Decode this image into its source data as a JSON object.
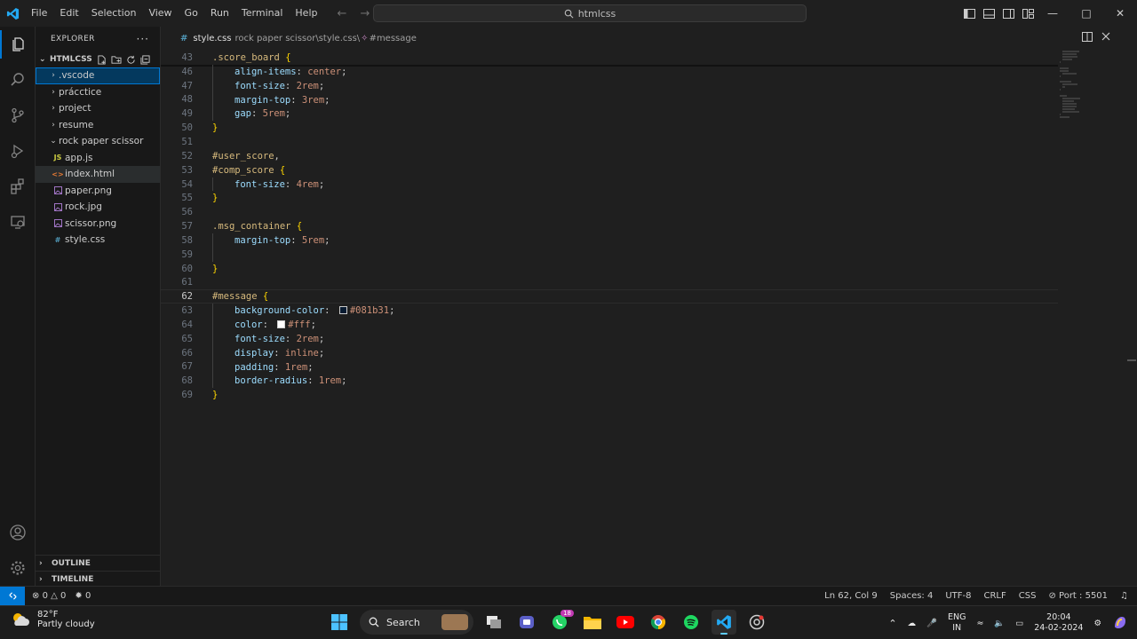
{
  "title_bar": {
    "menu": [
      "File",
      "Edit",
      "Selection",
      "View",
      "Go",
      "Run",
      "Terminal",
      "Help"
    ],
    "command_center": "htmlcss",
    "colors": {
      "accent": "#0078d4",
      "selection_bg": "#04395e"
    }
  },
  "sidebar": {
    "header": "EXPLORER",
    "root": "HTMLCSS",
    "tree": [
      {
        "label": ".vscode",
        "type": "folder",
        "expanded": false,
        "depth": 0,
        "selected": true
      },
      {
        "label": "prácctice",
        "type": "folder",
        "expanded": false,
        "depth": 0
      },
      {
        "label": "project",
        "type": "folder",
        "expanded": false,
        "depth": 0
      },
      {
        "label": "resume",
        "type": "folder",
        "expanded": false,
        "depth": 0
      },
      {
        "label": "rock paper scissor",
        "type": "folder",
        "expanded": true,
        "depth": 0
      },
      {
        "label": "app.js",
        "type": "js",
        "depth": 1,
        "icon_text": "JS"
      },
      {
        "label": "index.html",
        "type": "html",
        "depth": 1,
        "icon_text": "<>",
        "hover": true
      },
      {
        "label": "paper.png",
        "type": "img",
        "depth": 1
      },
      {
        "label": "rock.jpg",
        "type": "img",
        "depth": 1
      },
      {
        "label": "scissor.png",
        "type": "img",
        "depth": 1
      },
      {
        "label": "style.css",
        "type": "css",
        "depth": 1,
        "icon_text": "#"
      }
    ],
    "outline": "OUTLINE",
    "timeline": "TIMELINE"
  },
  "editor": {
    "tab_file": "style.css",
    "breadcrumb_path": "rock paper scissor\\style.css\\",
    "breadcrumb_symbol": "#message",
    "current_line": 62,
    "sticky": {
      "ln": 43,
      "tokens": [
        [
          ".score_board",
          "sel"
        ],
        [
          " ",
          "punc"
        ],
        [
          "{",
          "brace"
        ]
      ]
    },
    "lines": [
      {
        "ln": 46,
        "indent": 1,
        "tokens": [
          [
            "align-items",
            "prop"
          ],
          [
            ": ",
            "punc"
          ],
          [
            "center",
            "val"
          ],
          [
            ";",
            "punc"
          ]
        ]
      },
      {
        "ln": 47,
        "indent": 1,
        "tokens": [
          [
            "font-size",
            "prop"
          ],
          [
            ": ",
            "punc"
          ],
          [
            "2rem",
            "val"
          ],
          [
            ";",
            "punc"
          ]
        ]
      },
      {
        "ln": 48,
        "indent": 1,
        "tokens": [
          [
            "margin-top",
            "prop"
          ],
          [
            ": ",
            "punc"
          ],
          [
            "3rem",
            "val"
          ],
          [
            ";",
            "punc"
          ]
        ]
      },
      {
        "ln": 49,
        "indent": 1,
        "tokens": [
          [
            "gap",
            "prop"
          ],
          [
            ": ",
            "punc"
          ],
          [
            "5rem",
            "val"
          ],
          [
            ";",
            "punc"
          ]
        ]
      },
      {
        "ln": 50,
        "indent": 0,
        "tokens": [
          [
            "}",
            "brace"
          ]
        ]
      },
      {
        "ln": 51,
        "indent": 0,
        "tokens": []
      },
      {
        "ln": 52,
        "indent": 0,
        "tokens": [
          [
            "#user_score",
            "sel"
          ],
          [
            ",",
            "punc"
          ]
        ]
      },
      {
        "ln": 53,
        "indent": 0,
        "tokens": [
          [
            "#comp_score",
            "sel"
          ],
          [
            " ",
            "punc"
          ],
          [
            "{",
            "brace"
          ]
        ]
      },
      {
        "ln": 54,
        "indent": 1,
        "tokens": [
          [
            "font-size",
            "prop"
          ],
          [
            ": ",
            "punc"
          ],
          [
            "4rem",
            "val"
          ],
          [
            ";",
            "punc"
          ]
        ]
      },
      {
        "ln": 55,
        "indent": 0,
        "tokens": [
          [
            "}",
            "brace"
          ]
        ]
      },
      {
        "ln": 56,
        "indent": 0,
        "tokens": []
      },
      {
        "ln": 57,
        "indent": 0,
        "tokens": [
          [
            ".msg_container",
            "sel"
          ],
          [
            " ",
            "punc"
          ],
          [
            "{",
            "brace"
          ]
        ]
      },
      {
        "ln": 58,
        "indent": 1,
        "tokens": [
          [
            "margin-top",
            "prop"
          ],
          [
            ": ",
            "punc"
          ],
          [
            "5rem",
            "val"
          ],
          [
            ";",
            "punc"
          ]
        ]
      },
      {
        "ln": 59,
        "indent": 1,
        "tokens": []
      },
      {
        "ln": 60,
        "indent": 0,
        "tokens": [
          [
            "}",
            "brace"
          ]
        ]
      },
      {
        "ln": 61,
        "indent": 0,
        "tokens": []
      },
      {
        "ln": 62,
        "indent": 0,
        "tokens": [
          [
            "#message",
            "sel"
          ],
          [
            " ",
            "punc"
          ],
          [
            "{",
            "brace"
          ]
        ]
      },
      {
        "ln": 63,
        "indent": 1,
        "tokens": [
          [
            "background-color",
            "prop"
          ],
          [
            ": ",
            "punc"
          ],
          [
            "#081b31",
            "val",
            "#081b31"
          ],
          [
            ";",
            "punc"
          ]
        ]
      },
      {
        "ln": 64,
        "indent": 1,
        "tokens": [
          [
            "color",
            "prop"
          ],
          [
            ": ",
            "punc"
          ],
          [
            "#fff",
            "val",
            "#ffffff"
          ],
          [
            ";",
            "punc"
          ]
        ]
      },
      {
        "ln": 65,
        "indent": 1,
        "tokens": [
          [
            "font-size",
            "prop"
          ],
          [
            ": ",
            "punc"
          ],
          [
            "2rem",
            "val"
          ],
          [
            ";",
            "punc"
          ]
        ]
      },
      {
        "ln": 66,
        "indent": 1,
        "tokens": [
          [
            "display",
            "prop"
          ],
          [
            ": ",
            "punc"
          ],
          [
            "inline",
            "val"
          ],
          [
            ";",
            "punc"
          ]
        ]
      },
      {
        "ln": 67,
        "indent": 1,
        "tokens": [
          [
            "padding",
            "prop"
          ],
          [
            ": ",
            "punc"
          ],
          [
            "1rem",
            "val"
          ],
          [
            ";",
            "punc"
          ]
        ]
      },
      {
        "ln": 68,
        "indent": 1,
        "tokens": [
          [
            "border-radius",
            "prop"
          ],
          [
            ": ",
            "punc"
          ],
          [
            "1rem",
            "val"
          ],
          [
            ";",
            "punc"
          ]
        ]
      },
      {
        "ln": 69,
        "indent": 0,
        "tokens": [
          [
            "}",
            "brace"
          ]
        ]
      }
    ]
  },
  "status_bar": {
    "errors": "0",
    "warnings": "0",
    "ports_left": "0",
    "cursor": "Ln 62, Col 9",
    "spaces": "Spaces: 4",
    "encoding": "UTF-8",
    "eol": "CRLF",
    "language": "CSS",
    "port": "Port : 5501"
  },
  "taskbar": {
    "temp": "82°F",
    "weather": "Partly cloudy",
    "search": "Search",
    "whatsapp_badge": "18",
    "lang_1": "ENG",
    "lang_2": "IN",
    "time": "20:04",
    "date": "24-02-2024"
  }
}
